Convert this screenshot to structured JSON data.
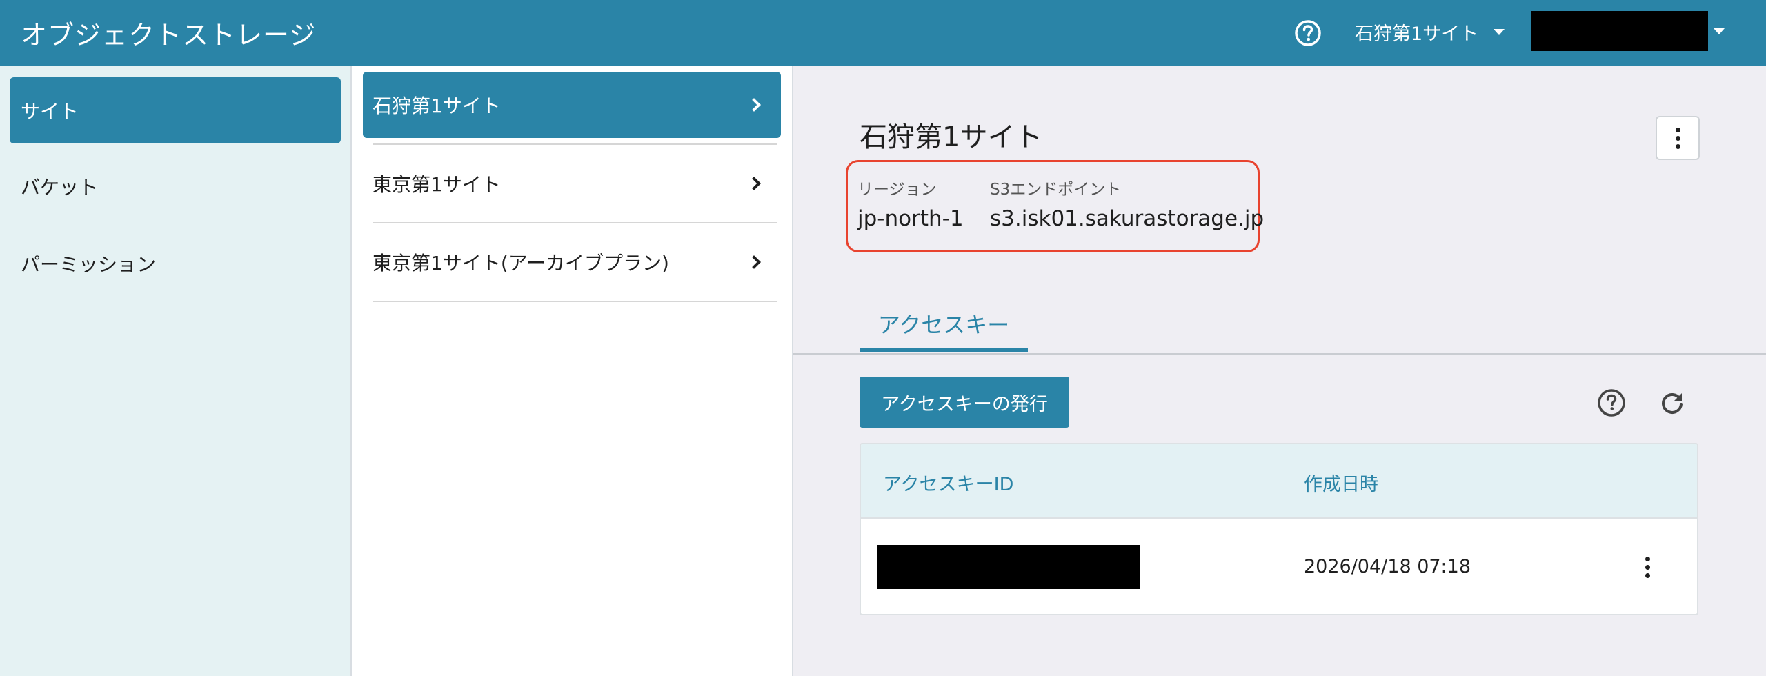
{
  "header": {
    "title": "オブジェクトストレージ",
    "help_icon": "help-circle-icon",
    "site_selector": "石狩第1サイト"
  },
  "leftnav": {
    "items": [
      {
        "label": "サイト",
        "active": true
      },
      {
        "label": "バケット",
        "active": false
      },
      {
        "label": "パーミッション",
        "active": false
      }
    ]
  },
  "sites": {
    "items": [
      {
        "label": "石狩第1サイト",
        "active": true
      },
      {
        "label": "東京第1サイト",
        "active": false
      },
      {
        "label": "東京第1サイト(アーカイブプラン)",
        "active": false
      }
    ]
  },
  "detail": {
    "title": "石狩第1サイト",
    "region_label": "リージョン",
    "region_value": "jp-north-1",
    "endpoint_label": "S3エンドポイント",
    "endpoint_value": "s3.isk01.sakurastorage.jp",
    "tab": "アクセスキー",
    "issue_button": "アクセスキーの発行",
    "table": {
      "headers": [
        "アクセスキーID",
        "作成日時"
      ],
      "rows": [
        {
          "created": "2026/04/18 07:18"
        }
      ]
    }
  },
  "colors": {
    "primary": "#2a84a7",
    "highlight_border": "#e8432f",
    "nav_bg": "#e5f2f3"
  }
}
